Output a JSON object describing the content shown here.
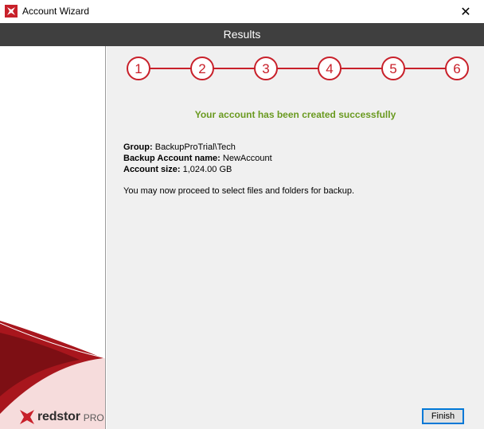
{
  "window": {
    "title": "Account Wizard",
    "close_glyph": "✕"
  },
  "header": {
    "title": "Results"
  },
  "steps": [
    "1",
    "2",
    "3",
    "4",
    "5",
    "6"
  ],
  "colors": {
    "brand_red": "#c8202a",
    "header_bg": "#3f3f3f",
    "success_green": "#6a9a20",
    "panel_bg": "#f0f0f0"
  },
  "main": {
    "success_message": "Your account has been created successfully",
    "info": {
      "group_label": "Group:",
      "group_value": " BackupProTrial\\Tech",
      "account_name_label": "Backup Account name:",
      "account_name_value": " NewAccount",
      "account_size_label": "Account size:",
      "account_size_value": " 1,024.00 GB"
    },
    "proceed_text": "You may now proceed to select files and folders for backup."
  },
  "sidebar": {
    "brand_name": "redstor",
    "brand_suffix": "PRO"
  },
  "footer": {
    "finish_label": "Finish"
  }
}
